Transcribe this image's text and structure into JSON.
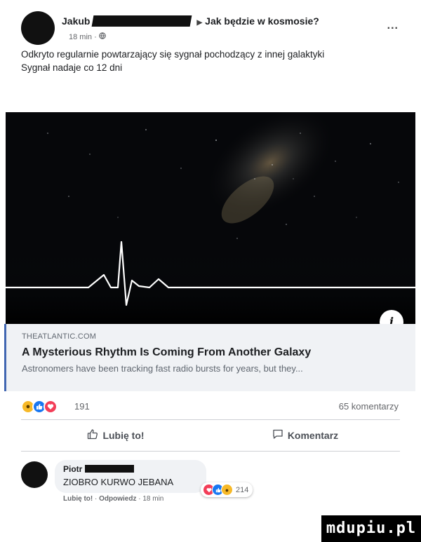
{
  "post": {
    "author": "Jakub",
    "group_separator": "▶",
    "group_name": "Jak będzie w kosmosie?",
    "time": "18 min",
    "privacy_icon": "globe-icon",
    "more_label": "...",
    "text_lines": [
      "Odkryto regularnie powtarzający się sygnał pochodzący z innej galaktyki",
      "Sygnał nadaje co 12 dni"
    ]
  },
  "link": {
    "info_label": "i",
    "domain": "THEATLANTIC.COM",
    "title": "A Mysterious Rhythm Is Coming From Another Galaxy",
    "description": "Astronomers have been tracking fast radio bursts for years, but they..."
  },
  "stats": {
    "reaction_icons": [
      "wow-icon",
      "like-icon",
      "love-icon"
    ],
    "reaction_count": "191",
    "comment_count": "65 komentarzy"
  },
  "actions": {
    "like_label": "Lubię to!",
    "comment_label": "Komentarz"
  },
  "comment": {
    "author": "Piotr",
    "text": "ZIOBRO KURWO JEBANA",
    "reaction_count": "214",
    "like_label": "Lubię to!",
    "reply_label": "Odpowiedz",
    "time": "18 min"
  },
  "watermark": "mdupiu.pl",
  "colors": {
    "like_blue": "#1877f2",
    "love_red": "#f33e58",
    "wow_yellow": "#f7b928",
    "link_bg": "#f0f2f5"
  }
}
